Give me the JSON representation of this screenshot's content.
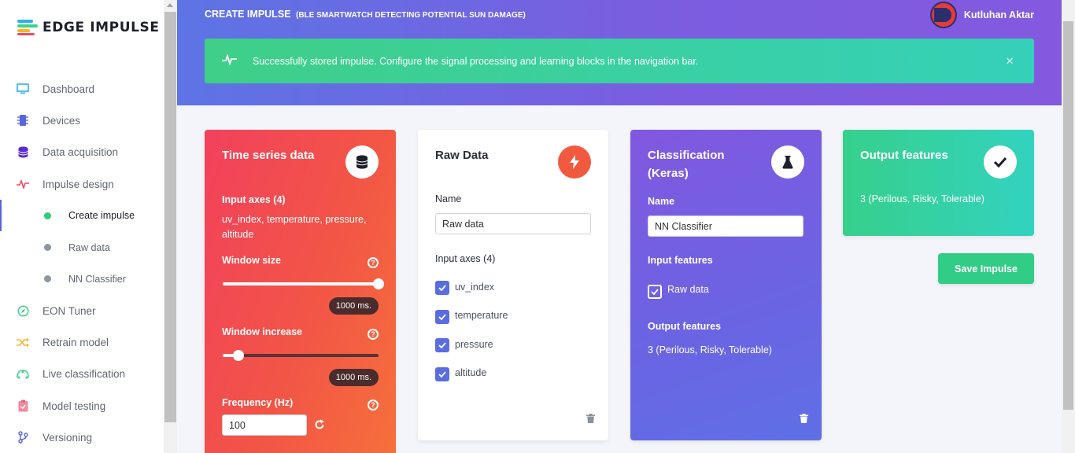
{
  "app": {
    "name": "EDGE IMPULSE",
    "colors": {
      "accent": "#5865dd",
      "success": "#2fcf7a"
    }
  },
  "sidebar": {
    "items": [
      {
        "label": "Dashboard",
        "icon": "monitor-icon"
      },
      {
        "label": "Devices",
        "icon": "chip-icon"
      },
      {
        "label": "Data acquisition",
        "icon": "database-icon"
      },
      {
        "label": "Impulse design",
        "icon": "pulse-icon"
      },
      {
        "label": "Create impulse",
        "sub": true,
        "active": true
      },
      {
        "label": "Raw data",
        "sub": true
      },
      {
        "label": "NN Classifier",
        "sub": true
      },
      {
        "label": "EON Tuner",
        "icon": "compass-icon"
      },
      {
        "label": "Retrain model",
        "icon": "shuffle-icon"
      },
      {
        "label": "Live classification",
        "icon": "live-icon"
      },
      {
        "label": "Model testing",
        "icon": "clipboard-check-icon"
      },
      {
        "label": "Versioning",
        "icon": "branch-icon"
      }
    ]
  },
  "header": {
    "title": "CREATE IMPULSE",
    "subtitle": "(BLE SMARTWATCH DETECTING POTENTIAL SUN DAMAGE)",
    "user": "Kutluhan Aktar"
  },
  "banner": {
    "message": "Successfully stored impulse. Configure the signal processing and learning blocks in the navigation bar.",
    "close": "×"
  },
  "time_series": {
    "title": "Time series data",
    "icon": "database-icon",
    "input_axes_label": "Input axes (4)",
    "input_axes_value": "uv_index, temperature, pressure, altitude",
    "window_size_label": "Window size",
    "window_size_value": "1000 ms.",
    "window_size_level": 1.0,
    "window_increase_label": "Window increase",
    "window_increase_value": "1000 ms.",
    "window_increase_level": 0.1,
    "frequency_label": "Frequency (Hz)",
    "frequency_value": "100",
    "help": "?"
  },
  "raw_data": {
    "title": "Raw Data",
    "icon": "bolt-icon",
    "name_label": "Name",
    "name_value": "Raw data",
    "input_axes_label": "Input axes (4)",
    "axes": [
      "uv_index",
      "temperature",
      "pressure",
      "altitude"
    ]
  },
  "classification": {
    "title_line1": "Classification",
    "title_line2": "(Keras)",
    "icon": "flask-icon",
    "name_label": "Name",
    "name_value": "NN Classifier",
    "input_features_label": "Input features",
    "input_feature": "Raw data",
    "output_features_label": "Output features",
    "output_features_value": "3 (Perilous, Risky, Tolerable)"
  },
  "output": {
    "title": "Output features",
    "icon": "checkmark-icon",
    "value": "3 (Perilous, Risky, Tolerable)"
  },
  "save_button": "Save Impulse"
}
